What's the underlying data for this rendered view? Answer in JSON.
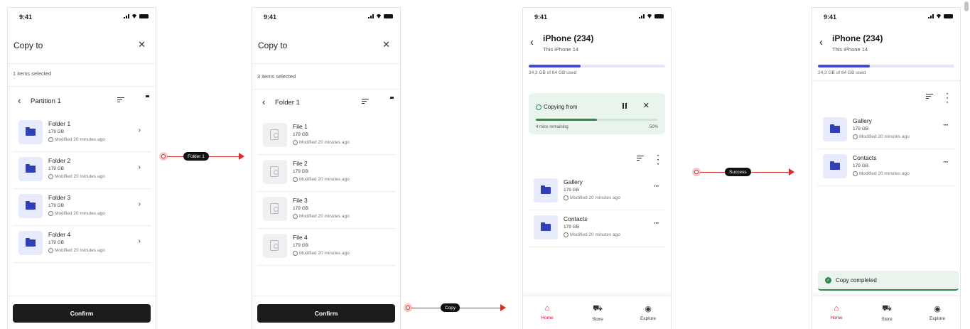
{
  "status_bar": {
    "time": "9:41"
  },
  "screen1": {
    "title": "Copy to",
    "selection": "1 items selected",
    "location": "Partition 1",
    "items": [
      {
        "name": "Folder 1",
        "size": "179 GB",
        "modified": "Modified 20 minutes ago"
      },
      {
        "name": "Folder 2",
        "size": "179 GB",
        "modified": "Modified 20 minutes ago"
      },
      {
        "name": "Folder 3",
        "size": "179 GB",
        "modified": "Modified 20 minutes ago"
      },
      {
        "name": "Folder 4",
        "size": "179 GB",
        "modified": "Modified 20 minutes ago"
      }
    ],
    "confirm_label": "Confirm"
  },
  "screen2": {
    "title": "Copy to",
    "selection": "3 items selected",
    "location": "Folder 1",
    "items": [
      {
        "name": "File 1",
        "size": "179 GB",
        "modified": "Modified 20 minutes ago"
      },
      {
        "name": "File 2",
        "size": "179 GB",
        "modified": "Modified 20 minutes ago"
      },
      {
        "name": "File 3",
        "size": "179 GB",
        "modified": "Modified 20 minutes ago"
      },
      {
        "name": "File 4",
        "size": "179 GB",
        "modified": "Modified 20 minutes ago"
      }
    ],
    "confirm_label": "Confirm"
  },
  "screen3": {
    "title": "iPhone (234)",
    "subtitle": "This iPhone 14",
    "usage_text": "24,3 GB of 64 GB used",
    "usage_fraction": 0.38,
    "copy_status": "Copying from",
    "copy_remaining": "4 mins remaining",
    "copy_percent_text": "50%",
    "copy_fraction": 0.5,
    "items": [
      {
        "name": "Gallery",
        "size": "179 GB",
        "modified": "Modified 20 minutes ago"
      },
      {
        "name": "Contacts",
        "size": "179 GB",
        "modified": "Modified 20 minutes ago"
      }
    ],
    "tabs": [
      {
        "label": "Home",
        "icon": "home-icon",
        "active": true
      },
      {
        "label": "Store",
        "icon": "cart-icon",
        "active": false
      },
      {
        "label": "Explore",
        "icon": "compass-icon",
        "active": false
      }
    ]
  },
  "screen4": {
    "title": "iPhone (234)",
    "subtitle": "This iPhone 14",
    "usage_text": "24,3 GB of 64 GB used",
    "usage_fraction": 0.38,
    "items": [
      {
        "name": "Gallery",
        "size": "179 GB",
        "modified": "Modified 20 minutes ago"
      },
      {
        "name": "Contacts",
        "size": "179 GB",
        "modified": "Modified 20 minutes ago"
      }
    ],
    "toast": "Copy completed",
    "tabs": [
      {
        "label": "Home",
        "icon": "home-icon",
        "active": true
      },
      {
        "label": "Store",
        "icon": "cart-icon",
        "active": false
      },
      {
        "label": "Explore",
        "icon": "compass-icon",
        "active": false
      }
    ]
  },
  "flows": [
    {
      "label": "Folder 1"
    },
    {
      "label": "Copy"
    },
    {
      "label": "Success"
    }
  ],
  "colors": {
    "accent": "#c8102e",
    "progress": "#4a4ad8",
    "success": "#2d8a4b",
    "folder": "#2f3fb5",
    "flow_arrow": "#d32f2f"
  }
}
